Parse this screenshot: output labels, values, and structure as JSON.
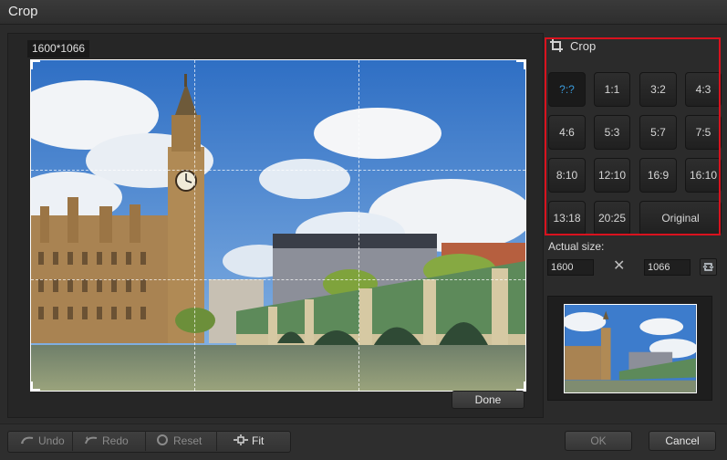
{
  "window": {
    "title": "Crop"
  },
  "canvas": {
    "dimensions_label": "1600*1066",
    "done_label": "Done"
  },
  "crop_panel": {
    "heading": "Crop",
    "ratios": [
      {
        "label": "?:?",
        "active": true
      },
      {
        "label": "1:1"
      },
      {
        "label": "3:2"
      },
      {
        "label": "4:3"
      },
      {
        "label": "4:6"
      },
      {
        "label": "5:3"
      },
      {
        "label": "5:7"
      },
      {
        "label": "7:5"
      },
      {
        "label": "8:10"
      },
      {
        "label": "12:10"
      },
      {
        "label": "16:9"
      },
      {
        "label": "16:10"
      },
      {
        "label": "13:18"
      },
      {
        "label": "20:25"
      },
      {
        "label": "Original"
      }
    ]
  },
  "actual_size": {
    "label": "Actual size:",
    "width": "1600",
    "separator": "✕",
    "height": "1066"
  },
  "toolbar": {
    "undo_label": "Undo",
    "redo_label": "Redo",
    "reset_label": "Reset",
    "fit_label": "Fit",
    "ok_label": "OK",
    "cancel_label": "Cancel"
  },
  "colors": {
    "highlight_border": "#d9121e",
    "active_ratio": "#3a9ad9"
  },
  "icons": [
    "crop-icon",
    "swap-icon",
    "undo-icon",
    "redo-icon",
    "reset-icon",
    "fit-icon"
  ]
}
